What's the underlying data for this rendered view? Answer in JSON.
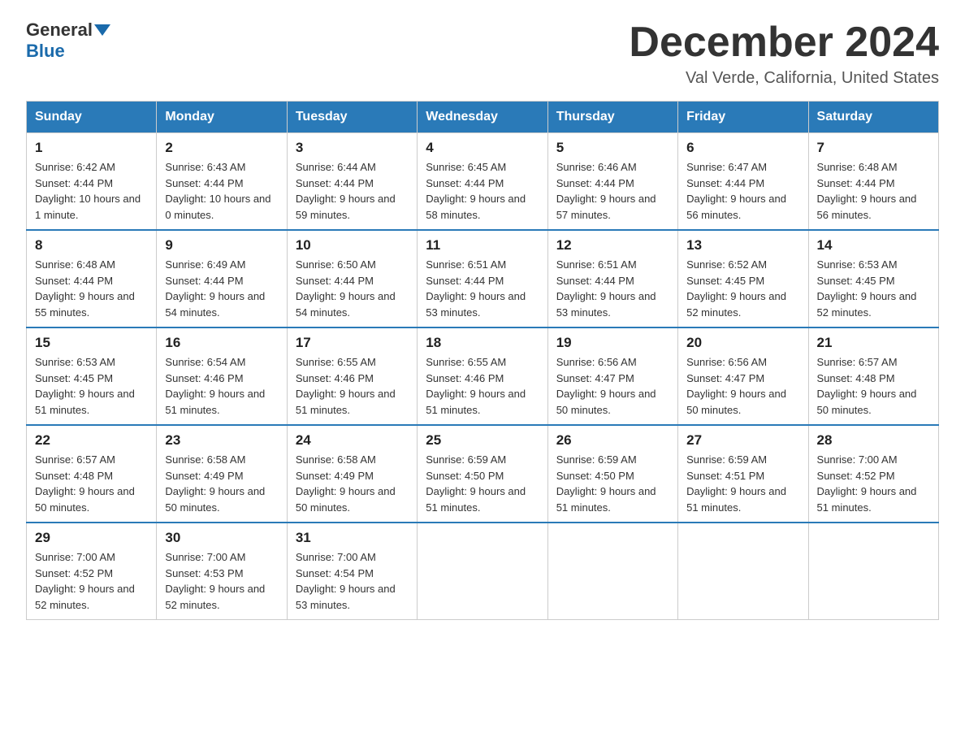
{
  "header": {
    "logo_general": "General",
    "logo_blue": "Blue",
    "month_title": "December 2024",
    "location": "Val Verde, California, United States"
  },
  "calendar": {
    "days_of_week": [
      "Sunday",
      "Monday",
      "Tuesday",
      "Wednesday",
      "Thursday",
      "Friday",
      "Saturday"
    ],
    "weeks": [
      [
        {
          "date": "1",
          "sunrise": "6:42 AM",
          "sunset": "4:44 PM",
          "daylight": "10 hours and 1 minute."
        },
        {
          "date": "2",
          "sunrise": "6:43 AM",
          "sunset": "4:44 PM",
          "daylight": "10 hours and 0 minutes."
        },
        {
          "date": "3",
          "sunrise": "6:44 AM",
          "sunset": "4:44 PM",
          "daylight": "9 hours and 59 minutes."
        },
        {
          "date": "4",
          "sunrise": "6:45 AM",
          "sunset": "4:44 PM",
          "daylight": "9 hours and 58 minutes."
        },
        {
          "date": "5",
          "sunrise": "6:46 AM",
          "sunset": "4:44 PM",
          "daylight": "9 hours and 57 minutes."
        },
        {
          "date": "6",
          "sunrise": "6:47 AM",
          "sunset": "4:44 PM",
          "daylight": "9 hours and 56 minutes."
        },
        {
          "date": "7",
          "sunrise": "6:48 AM",
          "sunset": "4:44 PM",
          "daylight": "9 hours and 56 minutes."
        }
      ],
      [
        {
          "date": "8",
          "sunrise": "6:48 AM",
          "sunset": "4:44 PM",
          "daylight": "9 hours and 55 minutes."
        },
        {
          "date": "9",
          "sunrise": "6:49 AM",
          "sunset": "4:44 PM",
          "daylight": "9 hours and 54 minutes."
        },
        {
          "date": "10",
          "sunrise": "6:50 AM",
          "sunset": "4:44 PM",
          "daylight": "9 hours and 54 minutes."
        },
        {
          "date": "11",
          "sunrise": "6:51 AM",
          "sunset": "4:44 PM",
          "daylight": "9 hours and 53 minutes."
        },
        {
          "date": "12",
          "sunrise": "6:51 AM",
          "sunset": "4:44 PM",
          "daylight": "9 hours and 53 minutes."
        },
        {
          "date": "13",
          "sunrise": "6:52 AM",
          "sunset": "4:45 PM",
          "daylight": "9 hours and 52 minutes."
        },
        {
          "date": "14",
          "sunrise": "6:53 AM",
          "sunset": "4:45 PM",
          "daylight": "9 hours and 52 minutes."
        }
      ],
      [
        {
          "date": "15",
          "sunrise": "6:53 AM",
          "sunset": "4:45 PM",
          "daylight": "9 hours and 51 minutes."
        },
        {
          "date": "16",
          "sunrise": "6:54 AM",
          "sunset": "4:46 PM",
          "daylight": "9 hours and 51 minutes."
        },
        {
          "date": "17",
          "sunrise": "6:55 AM",
          "sunset": "4:46 PM",
          "daylight": "9 hours and 51 minutes."
        },
        {
          "date": "18",
          "sunrise": "6:55 AM",
          "sunset": "4:46 PM",
          "daylight": "9 hours and 51 minutes."
        },
        {
          "date": "19",
          "sunrise": "6:56 AM",
          "sunset": "4:47 PM",
          "daylight": "9 hours and 50 minutes."
        },
        {
          "date": "20",
          "sunrise": "6:56 AM",
          "sunset": "4:47 PM",
          "daylight": "9 hours and 50 minutes."
        },
        {
          "date": "21",
          "sunrise": "6:57 AM",
          "sunset": "4:48 PM",
          "daylight": "9 hours and 50 minutes."
        }
      ],
      [
        {
          "date": "22",
          "sunrise": "6:57 AM",
          "sunset": "4:48 PM",
          "daylight": "9 hours and 50 minutes."
        },
        {
          "date": "23",
          "sunrise": "6:58 AM",
          "sunset": "4:49 PM",
          "daylight": "9 hours and 50 minutes."
        },
        {
          "date": "24",
          "sunrise": "6:58 AM",
          "sunset": "4:49 PM",
          "daylight": "9 hours and 50 minutes."
        },
        {
          "date": "25",
          "sunrise": "6:59 AM",
          "sunset": "4:50 PM",
          "daylight": "9 hours and 51 minutes."
        },
        {
          "date": "26",
          "sunrise": "6:59 AM",
          "sunset": "4:50 PM",
          "daylight": "9 hours and 51 minutes."
        },
        {
          "date": "27",
          "sunrise": "6:59 AM",
          "sunset": "4:51 PM",
          "daylight": "9 hours and 51 minutes."
        },
        {
          "date": "28",
          "sunrise": "7:00 AM",
          "sunset": "4:52 PM",
          "daylight": "9 hours and 51 minutes."
        }
      ],
      [
        {
          "date": "29",
          "sunrise": "7:00 AM",
          "sunset": "4:52 PM",
          "daylight": "9 hours and 52 minutes."
        },
        {
          "date": "30",
          "sunrise": "7:00 AM",
          "sunset": "4:53 PM",
          "daylight": "9 hours and 52 minutes."
        },
        {
          "date": "31",
          "sunrise": "7:00 AM",
          "sunset": "4:54 PM",
          "daylight": "9 hours and 53 minutes."
        },
        null,
        null,
        null,
        null
      ]
    ]
  }
}
